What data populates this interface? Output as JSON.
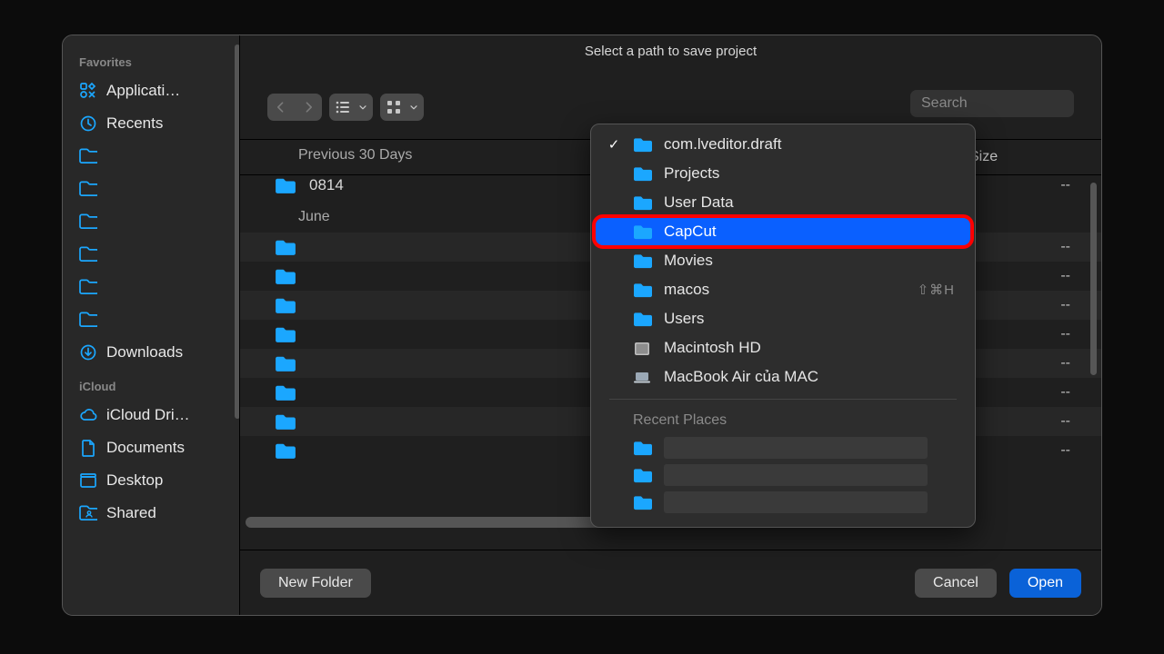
{
  "dialog": {
    "title": "Select a path to save project",
    "search_placeholder": "Search",
    "new_folder": "New Folder",
    "cancel": "Cancel",
    "open": "Open"
  },
  "sidebar": {
    "sections": [
      {
        "title": "Favorites",
        "items": [
          {
            "icon": "app",
            "label": "Applicati…",
            "dim": false
          },
          {
            "icon": "clock",
            "label": "Recents",
            "dim": false
          },
          {
            "icon": "folder",
            "label": "",
            "dim": true
          },
          {
            "icon": "folder",
            "label": "",
            "dim": true
          },
          {
            "icon": "folder",
            "label": "",
            "dim": true
          },
          {
            "icon": "folder",
            "label": "",
            "dim": true
          },
          {
            "icon": "folder",
            "label": "",
            "dim": true
          },
          {
            "icon": "folder",
            "label": "",
            "dim": true
          },
          {
            "icon": "download",
            "label": "Downloads",
            "dim": false
          }
        ]
      },
      {
        "title": "iCloud",
        "items": [
          {
            "icon": "cloud",
            "label": "iCloud Dri…",
            "dim": false
          },
          {
            "icon": "doc",
            "label": "Documents",
            "dim": false
          },
          {
            "icon": "desktop",
            "label": "Desktop",
            "dim": false
          },
          {
            "icon": "shared",
            "label": "Shared",
            "dim": false
          }
        ]
      }
    ]
  },
  "columns": {
    "size": "Size"
  },
  "listing": {
    "groups": [
      {
        "title": "Previous 30 Days",
        "rows": [
          {
            "name": "0814",
            "size": "--",
            "alt": false
          }
        ]
      },
      {
        "title": "June",
        "rows": [
          {
            "name": "",
            "size": "--",
            "alt": true
          },
          {
            "name": "",
            "size": "--",
            "alt": false
          },
          {
            "name": "",
            "size": "--",
            "alt": true
          },
          {
            "name": "",
            "size": "--",
            "alt": false
          },
          {
            "name": "",
            "size": "--",
            "alt": true
          },
          {
            "name": "",
            "size": "--",
            "alt": false
          },
          {
            "name": "",
            "size": "--",
            "alt": true
          },
          {
            "name": "",
            "size": "--",
            "alt": false
          }
        ]
      }
    ]
  },
  "popup": {
    "items": [
      {
        "label": "com.lveditor.draft",
        "icon": "folder",
        "checked": true
      },
      {
        "label": "Projects",
        "icon": "folder"
      },
      {
        "label": "User Data",
        "icon": "folder"
      },
      {
        "label": "CapCut",
        "icon": "folder",
        "selected": true,
        "highlight": true
      },
      {
        "label": "Movies",
        "icon": "folder"
      },
      {
        "label": "macos",
        "icon": "folder",
        "shortcut": "⇧⌘H"
      },
      {
        "label": "Users",
        "icon": "folder"
      },
      {
        "label": "Macintosh HD",
        "icon": "disk"
      },
      {
        "label": "MacBook Air của MAC",
        "icon": "laptop"
      }
    ],
    "recent_title": "Recent Places",
    "recent_count": 3
  }
}
